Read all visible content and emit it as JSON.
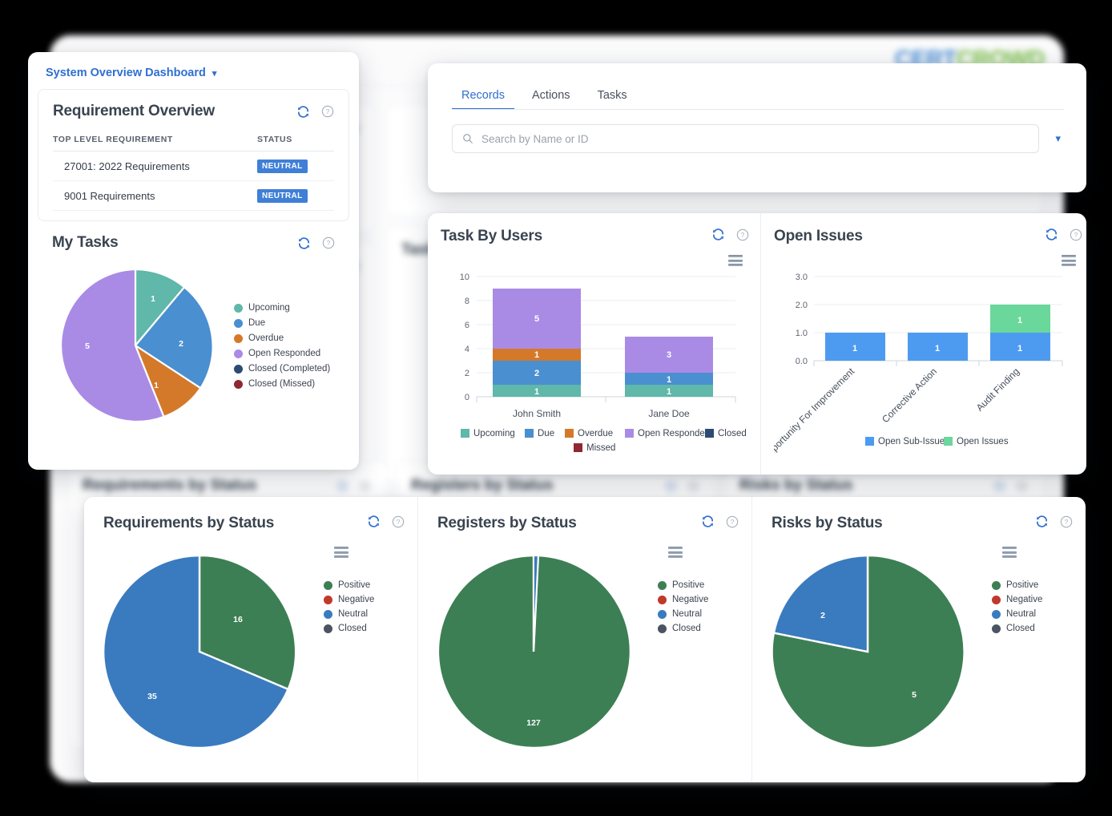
{
  "brand": {
    "part1": "CERT",
    "part2": "CROWD",
    "color1": "#4b8fd4",
    "color2": "#7cc04a"
  },
  "dashboard_selector": {
    "label": "System Overview Dashboard",
    "caret": "chevron-down-icon"
  },
  "requirement_overview": {
    "title": "Requirement Overview",
    "columns": [
      "TOP LEVEL REQUIREMENT",
      "STATUS"
    ],
    "rows": [
      {
        "name": "27001: 2022 Requirements",
        "status": "NEUTRAL"
      },
      {
        "name": "9001 Requirements",
        "status": "NEUTRAL"
      }
    ],
    "badge_color": "#3f7fd6"
  },
  "my_tasks": {
    "title": "My Tasks",
    "chart_data": {
      "type": "pie",
      "title": "My Tasks",
      "categories": [
        "Upcoming",
        "Due",
        "Overdue",
        "Open Responded",
        "Closed (Completed)",
        "Closed (Missed)"
      ],
      "values": [
        1,
        2,
        1,
        5,
        0,
        0
      ],
      "colors": [
        "#5fb8aa",
        "#4a8fd0",
        "#d4792a",
        "#a98be6",
        "#2c4a74",
        "#8e2832"
      ],
      "labels_shown": [
        "1",
        "2",
        "1",
        "5"
      ],
      "legend_position": "right"
    }
  },
  "records_panel": {
    "tabs": [
      {
        "label": "Records",
        "active": true
      },
      {
        "label": "Actions",
        "active": false
      },
      {
        "label": "Tasks",
        "active": false
      }
    ],
    "search": {
      "placeholder": "Search by Name or ID",
      "value": "",
      "icon": "search-icon",
      "expander": "chevron-down-icon"
    }
  },
  "task_by_users": {
    "title": "Task By Users",
    "chart_data": {
      "type": "bar",
      "stacked": true,
      "title": "Task By Users",
      "categories": [
        "John Smith",
        "Jane Doe"
      ],
      "series": [
        {
          "name": "Upcoming",
          "color": "#5fb8aa",
          "values": [
            1,
            1
          ]
        },
        {
          "name": "Due",
          "color": "#4a8fd0",
          "values": [
            2,
            1
          ]
        },
        {
          "name": "Overdue",
          "color": "#d4792a",
          "values": [
            1,
            0
          ]
        },
        {
          "name": "Open Responded",
          "color": "#a98be6",
          "values": [
            5,
            3
          ]
        },
        {
          "name": "Closed",
          "color": "#2c4a74",
          "values": [
            0,
            0
          ]
        },
        {
          "name": "Missed",
          "color": "#8e2832",
          "values": [
            0,
            0
          ]
        }
      ],
      "totals": [
        9,
        5
      ],
      "ylim": [
        0,
        10
      ],
      "yticks": [
        "0",
        "2",
        "4",
        "6",
        "8",
        "10"
      ],
      "xlabel": "",
      "ylabel": "",
      "grid": true,
      "legend_position": "bottom"
    }
  },
  "open_issues": {
    "title": "Open Issues",
    "chart_data": {
      "type": "bar",
      "stacked": true,
      "title": "Open Issues",
      "categories": [
        "Opportunity For Improvement",
        "Corrective Action",
        "Audit Finding"
      ],
      "series": [
        {
          "name": "Open Sub-Issues",
          "color": "#4d9bf0",
          "values": [
            1,
            1,
            1
          ]
        },
        {
          "name": "Open Issues",
          "color": "#6ad79b",
          "values": [
            0,
            0,
            1
          ]
        }
      ],
      "ylim": [
        0,
        3
      ],
      "yticks": [
        "0.0",
        "1.0",
        "2.0",
        "3.0"
      ],
      "xlabel": "",
      "ylabel": "",
      "grid": true,
      "legend_position": "bottom"
    }
  },
  "requirements_by_status": {
    "title": "Requirements by Status",
    "chart_data": {
      "type": "pie",
      "title": "Requirements by Status",
      "categories": [
        "Positive",
        "Negative",
        "Neutral",
        "Closed"
      ],
      "values": [
        16,
        0,
        35,
        0
      ],
      "colors": [
        "#3d7f54",
        "#c0392b",
        "#3a7bbf",
        "#4a5462"
      ],
      "labels_shown": [
        "16",
        "35"
      ],
      "legend_position": "right"
    }
  },
  "registers_by_status": {
    "title": "Registers by Status",
    "chart_data": {
      "type": "pie",
      "title": "Registers by Status",
      "categories": [
        "Positive",
        "Negative",
        "Neutral",
        "Closed"
      ],
      "values": [
        127,
        0,
        1,
        0
      ],
      "colors": [
        "#3d7f54",
        "#c0392b",
        "#3a7bbf",
        "#4a5462"
      ],
      "labels_shown": [
        "127"
      ],
      "legend_position": "right"
    }
  },
  "risks_by_status": {
    "title": "Risks by Status",
    "chart_data": {
      "type": "pie",
      "title": "Risks by Status",
      "categories": [
        "Positive",
        "Negative",
        "Neutral",
        "Closed"
      ],
      "values": [
        5,
        0,
        2,
        0
      ],
      "colors": [
        "#3d7f54",
        "#c0392b",
        "#3a7bbf",
        "#4a5462"
      ],
      "labels_shown": [
        "5",
        "2"
      ],
      "legend_position": "right"
    }
  },
  "icons": {
    "refresh": "refresh-icon",
    "help": "help-icon",
    "menu": "hamburger-menu-icon"
  }
}
